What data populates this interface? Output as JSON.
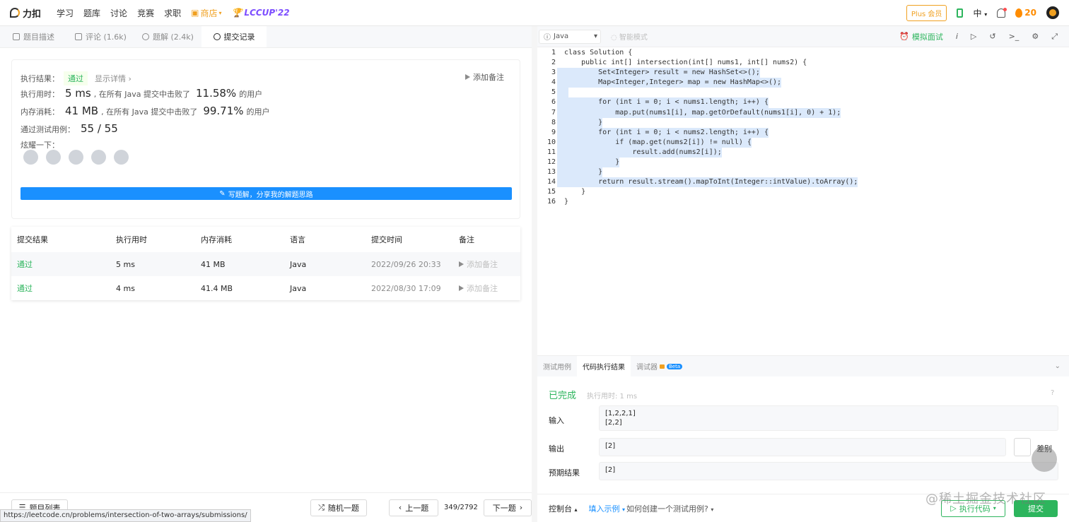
{
  "nav": {
    "brand": "力扣",
    "items": [
      "学习",
      "题库",
      "讨论",
      "竞赛",
      "求职"
    ],
    "shop": "商店",
    "lccup": "LCCUP'22",
    "plus": "Plus 会员",
    "lang": "中",
    "streak": "20"
  },
  "tabs": [
    {
      "label": "题目描述"
    },
    {
      "label": "评论 (1.6k)"
    },
    {
      "label": "题解 (2.4k)"
    },
    {
      "label": "提交记录"
    }
  ],
  "result": {
    "status_label": "执行结果：",
    "status": "通过",
    "detail": "显示详情 ›",
    "add_note": "添加备注",
    "time_label": "执行用时：",
    "time_value": "5 ms",
    "time_text": ", 在所有 Java 提交中击败了",
    "time_pct": "11.58%",
    "users": "的用户",
    "mem_label": "内存消耗：",
    "mem_value": "41 MB",
    "mem_text": ", 在所有 Java 提交中击败了",
    "mem_pct": "99.71%",
    "cases_label": "通过测试用例：",
    "cases_value": "55 / 55",
    "share_label": "炫耀一下：",
    "share_icons": [
      "wechat-icon",
      "weibo-icon",
      "qq-icon",
      "douban-icon",
      "linkedin-icon"
    ],
    "write_btn": "写题解，分享我的解题思路"
  },
  "submissions": {
    "headers": [
      "提交结果",
      "执行用时",
      "内存消耗",
      "语言",
      "提交时间",
      "备注"
    ],
    "rows": [
      {
        "result": "通过",
        "time": "5 ms",
        "mem": "41 MB",
        "lang": "Java",
        "date": "2022/09/26 20:33",
        "note": "添加备注"
      },
      {
        "result": "通过",
        "time": "4 ms",
        "mem": "41.4 MB",
        "lang": "Java",
        "date": "2022/08/30 17:09",
        "note": "添加备注"
      }
    ]
  },
  "footer_left": {
    "list": "题目列表",
    "random": "随机一题",
    "prev": "上一题",
    "counter": "349/2792",
    "next": "下一题",
    "url": "https://leetcode.cn/problems/intersection-of-two-arrays/submissions/"
  },
  "editor": {
    "language": "Java",
    "smart_mode": "智能模式",
    "mock": "模拟面试",
    "lines": [
      "class Solution {",
      "    public int[] intersection(int[] nums1, int[] nums2) {",
      "        Set<Integer> result = new HashSet<>();",
      "        Map<Integer,Integer> map = new HashMap<>();",
      "",
      "        for (int i = 0; i < nums1.length; i++) {",
      "            map.put(nums1[i], map.getOrDefault(nums1[i], 0) + 1);",
      "        }",
      "        for (int i = 0; i < nums2.length; i++) {",
      "            if (map.get(nums2[i]) != null) {",
      "                result.add(nums2[i]);",
      "            }",
      "        }",
      "        return result.stream().mapToInt(Integer::intValue).toArray();",
      "    }",
      "}"
    ]
  },
  "console": {
    "tabs": [
      "测试用例",
      "代码执行结果",
      "调试器"
    ],
    "beta": "Beta",
    "done": "已完成",
    "ran": "执行用时: 1 ms",
    "input_label": "输入",
    "input_value": "[1,2,2,1]\n[2,2]",
    "output_label": "输出",
    "output_value": "[2]",
    "diff": "差别",
    "expected_label": "预期结果",
    "expected_value": "[2]",
    "console_btn": "控制台",
    "fill_example": "填入示例",
    "how_to": "如何创建一个测试用例?",
    "run": "执行代码",
    "submit": "提交"
  },
  "watermark": "@稀土掘金技术社区"
}
